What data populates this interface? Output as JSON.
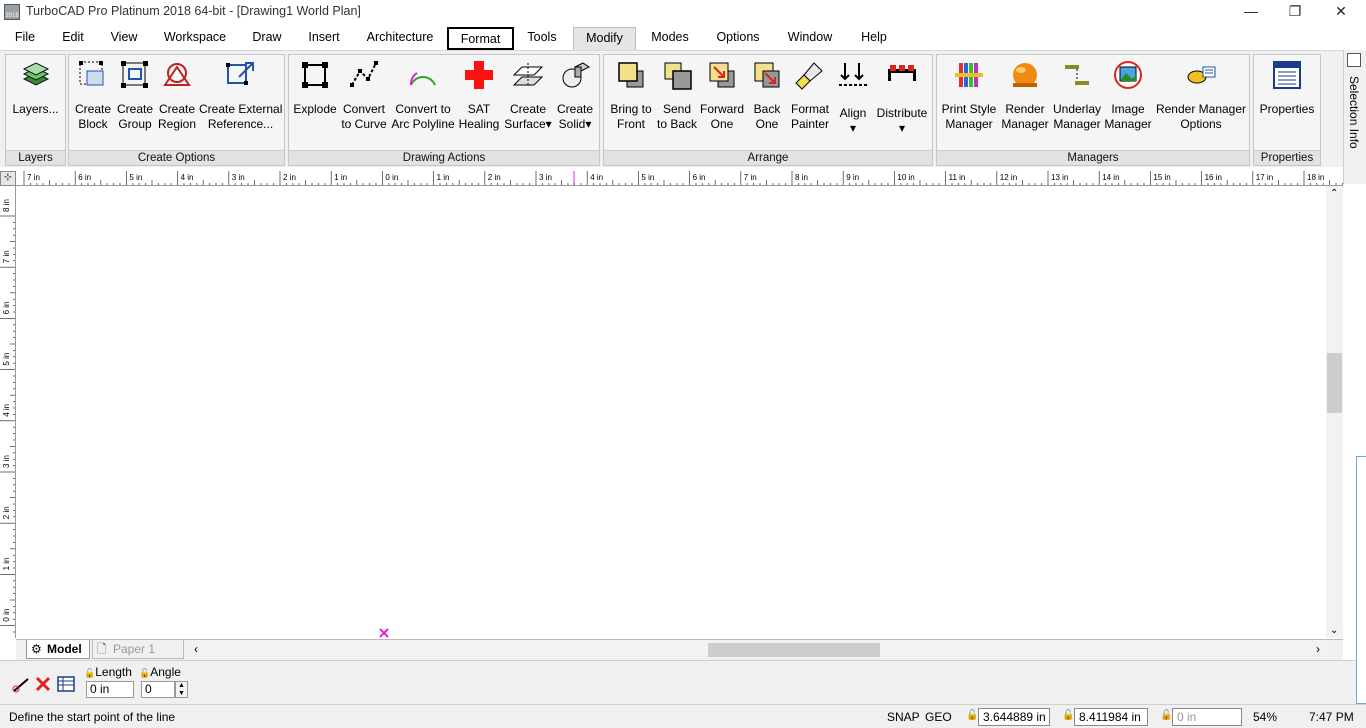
{
  "window": {
    "title": "TurboCAD Pro Platinum 2018 64-bit - [Drawing1 World Plan]",
    "app_icon_text": "2018",
    "minimize": "—",
    "restore": "❐",
    "close": "✕"
  },
  "menu": [
    "File",
    "Edit",
    "View",
    "Workspace",
    "Draw",
    "Insert",
    "Architecture",
    "Format",
    "Tools",
    "Modify",
    "Modes",
    "Options",
    "Window",
    "Help"
  ],
  "mdi_controls": [
    "–",
    "⧉",
    "✕"
  ],
  "ribbon": {
    "groups": [
      "Layers",
      "Create Options",
      "Drawing Actions",
      "Arrange",
      "Managers",
      "Properties"
    ],
    "layers": {
      "label1": "Layers...",
      "label2": ""
    },
    "create_block": {
      "label1": "Create",
      "label2": "Block"
    },
    "create_group": {
      "label1": "Create",
      "label2": "Group"
    },
    "create_region": {
      "label1": "Create",
      "label2": "Region"
    },
    "create_external_ref": {
      "label1": "Create External",
      "label2": "Reference..."
    },
    "explode": {
      "label1": "Explode",
      "label2": ""
    },
    "convert_curve": {
      "label1": "Convert",
      "label2": "to Curve"
    },
    "convert_arc": {
      "label1": "Convert  to",
      "label2": "Arc Polyline"
    },
    "sat_healing": {
      "label1": "SAT",
      "label2": "Healing"
    },
    "create_surface": {
      "label1": "Create",
      "label2": "Surface▾"
    },
    "create_solid": {
      "label1": "Create",
      "label2": "Solid▾"
    },
    "bring_front": {
      "label1": "Bring to",
      "label2": "Front"
    },
    "send_back": {
      "label1": "Send",
      "label2": "to Back"
    },
    "forward_one": {
      "label1": "Forward",
      "label2": "One"
    },
    "back_one": {
      "label1": "Back",
      "label2": "One"
    },
    "format_painter": {
      "label1": "Format",
      "label2": "Painter"
    },
    "align": {
      "label1": "Align",
      "label2": "▾"
    },
    "distribute": {
      "label1": "Distribute",
      "label2": "▾"
    },
    "print_style": {
      "label1": "Print Style",
      "label2": "Manager"
    },
    "render_mgr": {
      "label1": "Render",
      "label2": "Manager"
    },
    "underlay_mgr": {
      "label1": "Underlay",
      "label2": "Manager"
    },
    "image_mgr": {
      "label1": "Image",
      "label2": "Manager"
    },
    "render_opts": {
      "label1": "Render Manager",
      "label2": "Options"
    },
    "properties": {
      "label1": "Properties",
      "label2": ""
    }
  },
  "side_panel": {
    "label": "Selection Info"
  },
  "rulers": {
    "horizontal": [
      "7 in",
      "6 in",
      "5 in",
      "4 in",
      "3 in",
      "2 in",
      "1 in",
      "0 in",
      "1 in",
      "2 in",
      "3 in",
      "4 in",
      "5 in",
      "6 in",
      "7 in",
      "8 in",
      "9 in",
      "10 in",
      "11 in",
      "12 in",
      "13 in",
      "14 in",
      "15 in",
      "16 in",
      "17 in",
      "18 in"
    ],
    "vertical": [
      "8 in",
      "7 in",
      "6 in",
      "5 in",
      "4 in",
      "3 in",
      "2 in",
      "1 in",
      "0 in"
    ]
  },
  "tabs": [
    {
      "label": "Model"
    },
    {
      "label": "Paper 1"
    }
  ],
  "inspector": {
    "length_label": "Length",
    "angle_label": "Angle",
    "length_value": "0 in",
    "angle_value": "0"
  },
  "status": {
    "prompt": "Define the start point of the line",
    "snap": "SNAP",
    "geo": "GEO",
    "x_value": "3.644889 in",
    "y_value": "8.411984 in",
    "z_value": "0 in",
    "zoom": "54%",
    "time": "7:47 PM"
  },
  "colors": {
    "accent": "#e020e0",
    "sat_red": "#ff1010",
    "ribbon_bg": "#f0f0f0"
  }
}
